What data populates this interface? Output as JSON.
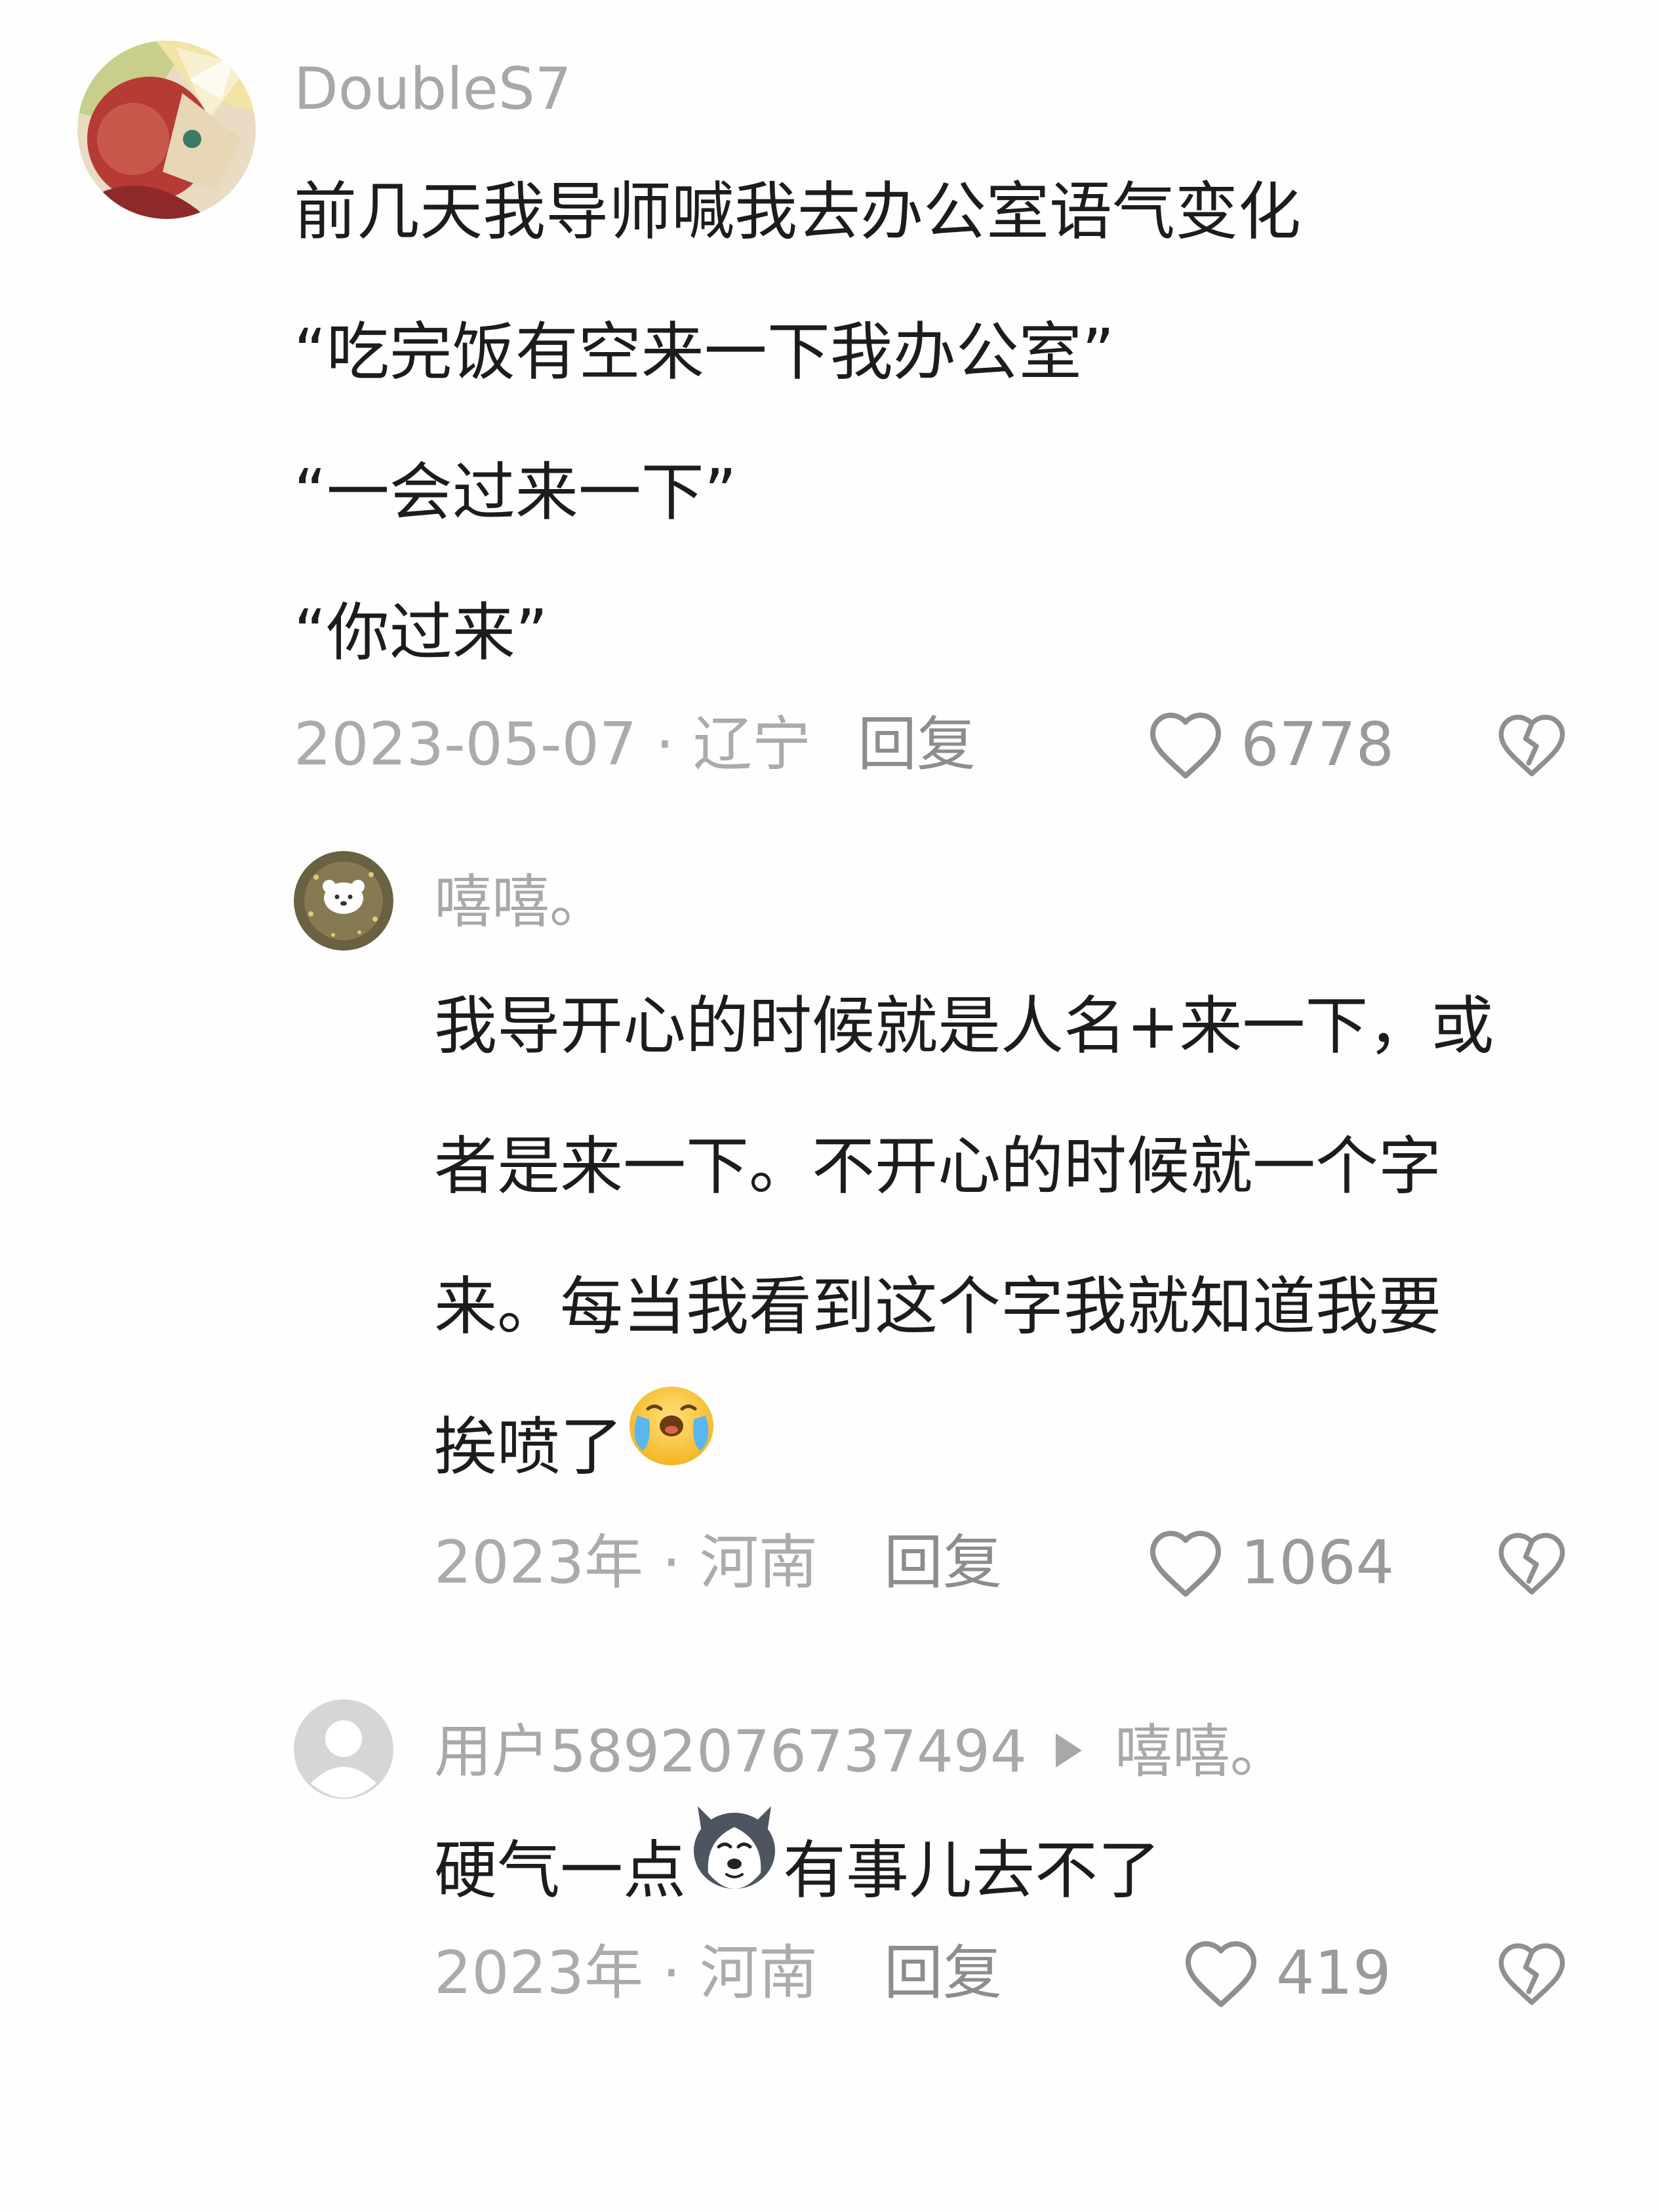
{
  "comments": [
    {
      "author": "DoubleS7",
      "lines": [
        "前几天我导师喊我去办公室语气变化",
        "“吃完饭有空来一下我办公室”",
        "“一会过来一下”",
        "“你过来”"
      ],
      "date_location": "2023-05-07 · 辽宁",
      "reply_label": "回复",
      "likes": "6778"
    },
    {
      "author": "嘻嘻。",
      "lines": [
        "我导开心的时候就是人名+来一下，或",
        "者是来一下。不开心的时候就一个字",
        "来。每当我看到这个字我就知道我要",
        "挨喷了"
      ],
      "emoji": "crying-face-emoji",
      "date_location": "2023年 · 河南",
      "reply_label": "回复",
      "likes": "1064"
    },
    {
      "author": "用户5892076737494",
      "reply_to": "嘻嘻。",
      "text_before": "硬气一点",
      "emoji": "husky-dog-emoji",
      "text_after": "有事儿去不了",
      "date_location": "2023年 · 河南",
      "reply_label": "回复",
      "likes": "419"
    }
  ],
  "icons": {
    "like": "heart-outline-icon",
    "dislike": "broken-heart-icon",
    "reply_to_marker": "play-triangle-icon"
  },
  "colors": {
    "muted_text": "#a8a8a8",
    "body_text": "#1c1c1c",
    "icon": "#9a9a9a"
  }
}
